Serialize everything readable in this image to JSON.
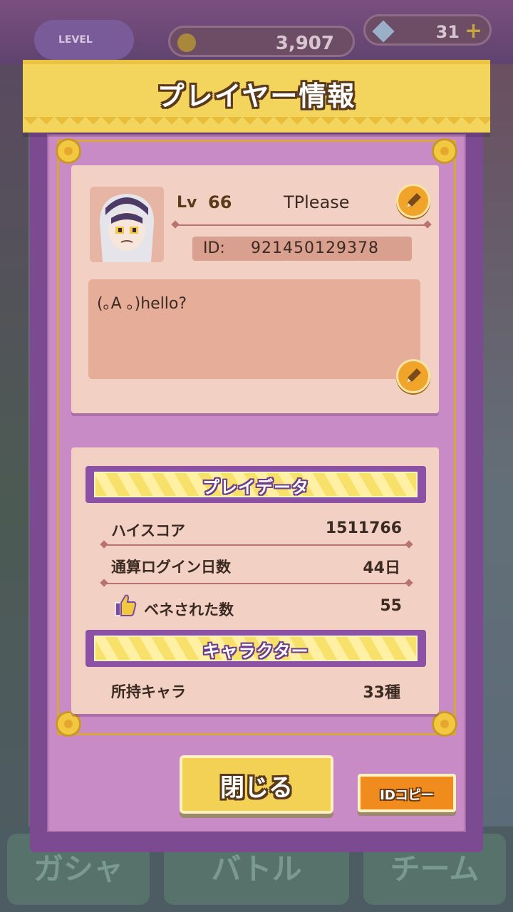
{
  "background": {
    "level_label": "LEVEL",
    "coins": "3,907",
    "gems": "31",
    "tabs": [
      "ガシャ",
      "バトル",
      "チーム"
    ]
  },
  "header": {
    "title": "プレイヤー情報"
  },
  "profile": {
    "lv_label": "Lv",
    "level": "66",
    "name": "TPlease",
    "id_label": "ID:",
    "id_value": "921450129378",
    "comment": "(｡A ｡)hello?"
  },
  "play_data": {
    "title": "プレイデータ",
    "rows": [
      {
        "label": "ハイスコア",
        "value": "1511766"
      },
      {
        "label": "通算ログイン日数",
        "value": "44日"
      },
      {
        "label": "ベネされた数",
        "value": "55"
      }
    ]
  },
  "character": {
    "title": "キャラクター",
    "rows": [
      {
        "label": "所持キャラ",
        "value": "33種"
      }
    ]
  },
  "buttons": {
    "close": "閉じる",
    "id_copy": "IDコピー"
  },
  "colors": {
    "header_yellow": "#f3d55d",
    "panel_purple": "#7c4a91",
    "card_pink": "#f2d1c4",
    "edit_orange": "#f0a52a"
  },
  "icons": [
    "pencil-icon",
    "thumbs-up-icon",
    "coin-icon",
    "gem-icon",
    "plus-icon"
  ]
}
